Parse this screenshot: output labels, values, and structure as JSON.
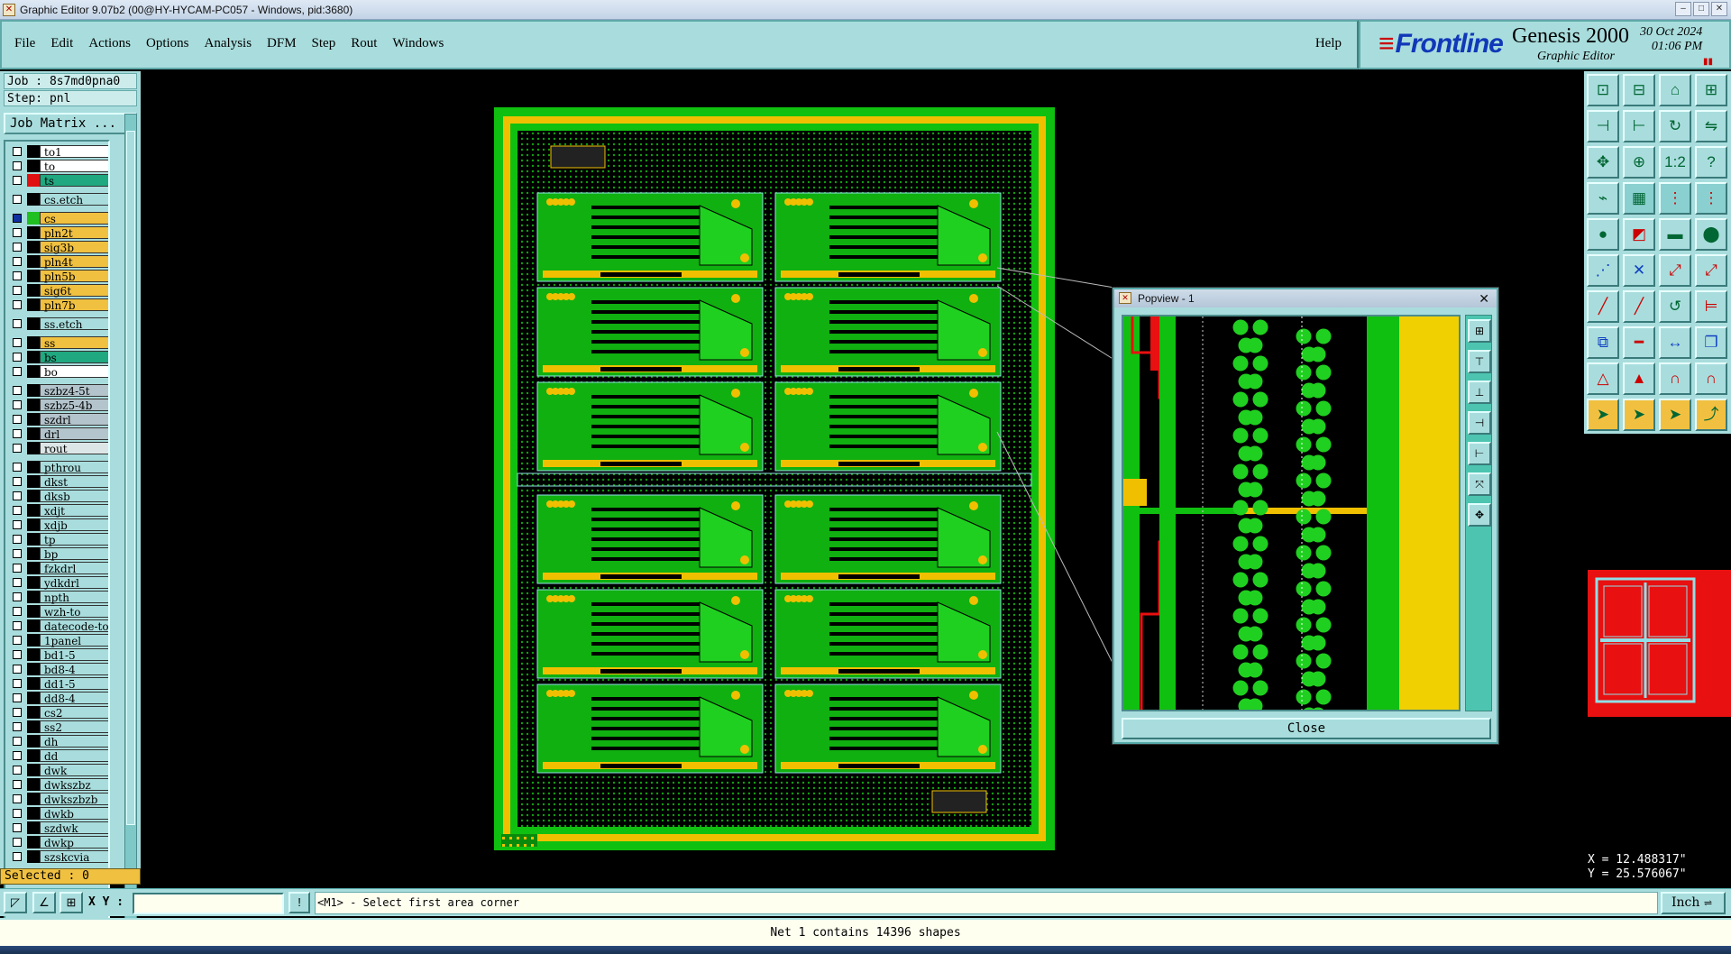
{
  "window": {
    "title": "Graphic Editor 9.07b2 (00@HY-HYCAM-PC057 - Windows, pid:3680)"
  },
  "menu": {
    "items": [
      "File",
      "Edit",
      "Actions",
      "Options",
      "Analysis",
      "DFM",
      "Step",
      "Rout",
      "Windows"
    ],
    "help": "Help"
  },
  "logo": {
    "brand": "Frontline",
    "product": "Genesis 2000",
    "subtitle": "Graphic Editor",
    "date": "30 Oct 2024",
    "time": "01:06 PM"
  },
  "job": {
    "job_label": "Job : 8s7md0pna0",
    "step_label": "Step: pnl",
    "matrix_button": "Job Matrix ..."
  },
  "layers": [
    {
      "name": "to1",
      "color": "#ffffff",
      "swatch": "#000000",
      "group": 0
    },
    {
      "name": "to",
      "color": "#ffffff",
      "swatch": "#000000",
      "group": 0
    },
    {
      "name": "ts",
      "color": "#20a880",
      "swatch": "#e01010",
      "group": 0
    },
    {
      "name": "cs.etch",
      "color": "#a9dddd",
      "swatch": "#000000",
      "group": 1
    },
    {
      "name": "cs",
      "color": "#f0c040",
      "swatch": "#20c020",
      "group": 2,
      "active": true
    },
    {
      "name": "pln2t",
      "color": "#f0c040",
      "swatch": "#000000",
      "group": 2
    },
    {
      "name": "sig3b",
      "color": "#f0c040",
      "swatch": "#000000",
      "group": 2
    },
    {
      "name": "pln4t",
      "color": "#f0c040",
      "swatch": "#000000",
      "group": 2
    },
    {
      "name": "pln5b",
      "color": "#f0c040",
      "swatch": "#000000",
      "group": 2
    },
    {
      "name": "sig6t",
      "color": "#f0c040",
      "swatch": "#000000",
      "group": 2
    },
    {
      "name": "pln7b",
      "color": "#f0c040",
      "swatch": "#000000",
      "group": 2
    },
    {
      "name": "ss.etch",
      "color": "#a9dddd",
      "swatch": "#000000",
      "group": 3
    },
    {
      "name": "ss",
      "color": "#f0c040",
      "swatch": "#000000",
      "group": 4
    },
    {
      "name": "bs",
      "color": "#20a880",
      "swatch": "#000000",
      "group": 4
    },
    {
      "name": "bo",
      "color": "#ffffff",
      "swatch": "#000000",
      "group": 4
    },
    {
      "name": "szbz4-5t",
      "color": "#b4c4cc",
      "swatch": "#000000",
      "group": 5
    },
    {
      "name": "szbz5-4b",
      "color": "#b4c4cc",
      "swatch": "#000000",
      "group": 5
    },
    {
      "name": "szdrl",
      "color": "#b4c4cc",
      "swatch": "#000000",
      "group": 5
    },
    {
      "name": "drl",
      "color": "#b4c4cc",
      "swatch": "#000000",
      "group": 5
    },
    {
      "name": "rout",
      "color": "#dde6e6",
      "swatch": "#000000",
      "group": 5
    },
    {
      "name": "pthrou",
      "color": "#a9dddd",
      "swatch": "#000000",
      "group": 6
    },
    {
      "name": "dkst",
      "color": "#a9dddd",
      "swatch": "#000000",
      "group": 6
    },
    {
      "name": "dksb",
      "color": "#a9dddd",
      "swatch": "#000000",
      "group": 6
    },
    {
      "name": "xdjt",
      "color": "#a9dddd",
      "swatch": "#000000",
      "group": 6
    },
    {
      "name": "xdjb",
      "color": "#a9dddd",
      "swatch": "#000000",
      "group": 6
    },
    {
      "name": "tp",
      "color": "#a9dddd",
      "swatch": "#000000",
      "group": 6
    },
    {
      "name": "bp",
      "color": "#a9dddd",
      "swatch": "#000000",
      "group": 6
    },
    {
      "name": "fzkdrl",
      "color": "#a9dddd",
      "swatch": "#000000",
      "group": 6
    },
    {
      "name": "ydkdrl",
      "color": "#a9dddd",
      "swatch": "#000000",
      "group": 6
    },
    {
      "name": "npth",
      "color": "#a9dddd",
      "swatch": "#000000",
      "group": 6
    },
    {
      "name": "wzh-to",
      "color": "#a9dddd",
      "swatch": "#000000",
      "group": 6
    },
    {
      "name": "datecode-to",
      "color": "#a9dddd",
      "swatch": "#000000",
      "group": 6
    },
    {
      "name": "1panel",
      "color": "#a9dddd",
      "swatch": "#000000",
      "group": 6
    },
    {
      "name": "bd1-5",
      "color": "#a9dddd",
      "swatch": "#000000",
      "group": 6
    },
    {
      "name": "bd8-4",
      "color": "#a9dddd",
      "swatch": "#000000",
      "group": 6
    },
    {
      "name": "dd1-5",
      "color": "#a9dddd",
      "swatch": "#000000",
      "group": 6
    },
    {
      "name": "dd8-4",
      "color": "#a9dddd",
      "swatch": "#000000",
      "group": 6
    },
    {
      "name": "cs2",
      "color": "#a9dddd",
      "swatch": "#000000",
      "group": 6
    },
    {
      "name": "ss2",
      "color": "#a9dddd",
      "swatch": "#000000",
      "group": 6
    },
    {
      "name": "dh",
      "color": "#a9dddd",
      "swatch": "#000000",
      "group": 6
    },
    {
      "name": "dd",
      "color": "#a9dddd",
      "swatch": "#000000",
      "group": 6
    },
    {
      "name": "dwk",
      "color": "#a9dddd",
      "swatch": "#000000",
      "group": 6
    },
    {
      "name": "dwkszbz",
      "color": "#a9dddd",
      "swatch": "#000000",
      "group": 6
    },
    {
      "name": "dwkszbzb",
      "color": "#a9dddd",
      "swatch": "#000000",
      "group": 6
    },
    {
      "name": "dwkb",
      "color": "#a9dddd",
      "swatch": "#000000",
      "group": 6
    },
    {
      "name": "szdwk",
      "color": "#a9dddd",
      "swatch": "#000000",
      "group": 6
    },
    {
      "name": "dwkp",
      "color": "#a9dddd",
      "swatch": "#000000",
      "group": 6
    },
    {
      "name": "szskcvia",
      "color": "#a9dddd",
      "swatch": "#000000",
      "group": 6
    }
  ],
  "selected": "Selected : 0",
  "popview": {
    "title": "Popview - 1",
    "close_label": "Close"
  },
  "coords": {
    "x": "X = 12.488317\"",
    "y": "Y = 25.576067\""
  },
  "bottom": {
    "xy_label": "X Y :",
    "xy_value": "",
    "prompt": "<M1> - Select first area corner",
    "unit": "Inch"
  },
  "status": "Net 1 contains 14396 shapes",
  "colors": {
    "board_green": "#10c010",
    "copper_yellow": "#f0c000",
    "panel_teal": "#a9dddd",
    "highlight_red": "#e81010"
  }
}
